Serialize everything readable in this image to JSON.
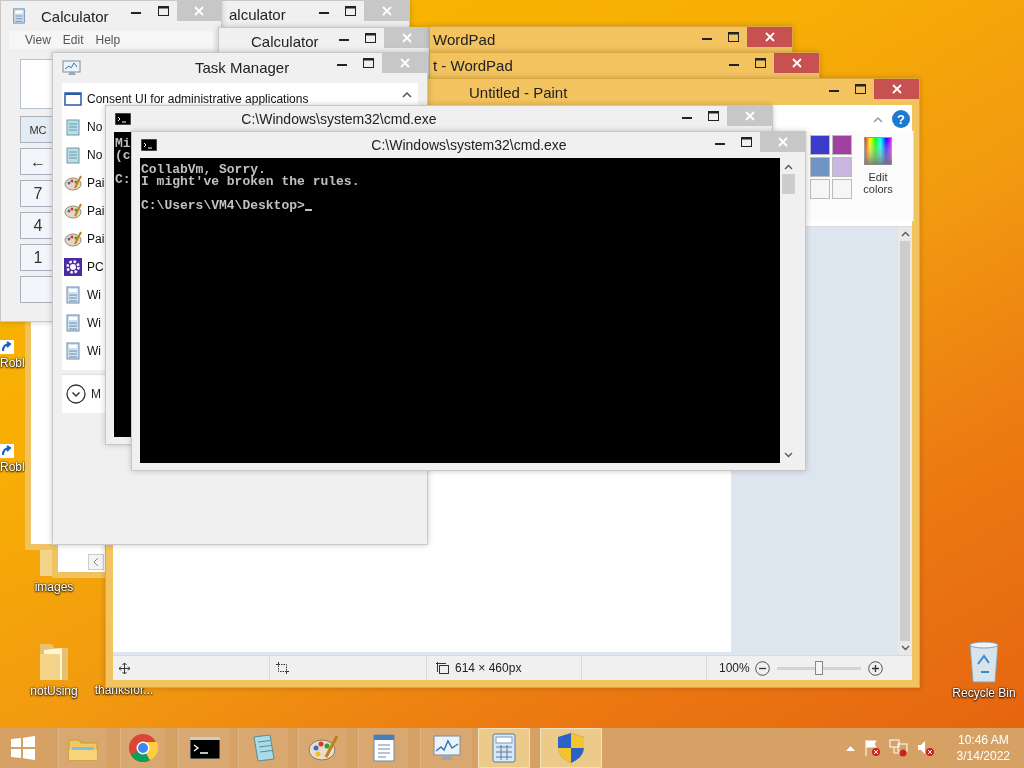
{
  "desktop": {
    "icons": [
      {
        "label": "Robl",
        "kind": "shortcut"
      },
      {
        "label": "Robl",
        "kind": "shortcut"
      },
      {
        "label": "images",
        "kind": "folder"
      },
      {
        "label": "notUsing",
        "kind": "folder"
      },
      {
        "label": "thanksfor...",
        "kind": "none"
      },
      {
        "label": "Recycle Bin",
        "kind": "bin"
      }
    ]
  },
  "calculators": [
    {
      "title": "Calculator",
      "menu": [
        "View",
        "Edit",
        "Help"
      ],
      "keys": [
        "MC",
        "←",
        "7",
        "4",
        "1"
      ]
    },
    {
      "title": "alculator"
    },
    {
      "title": "Calculator"
    }
  ],
  "wordpads": [
    {
      "title": "WordPad"
    },
    {
      "title": "t - WordPad"
    }
  ],
  "paint": {
    "title": "Untitled - Paint",
    "help": "?",
    "palette": [
      {
        "color": "#3c3ccc"
      },
      {
        "color": "#a040a0"
      },
      {
        "color": "#7094c4"
      },
      {
        "color": "#c8b8e0"
      },
      {
        "color": "#f6f6f6"
      },
      {
        "color": "#f6f6f6"
      }
    ],
    "edit_colors": "Edit colors",
    "status": {
      "size": "614 × 460px",
      "zoom": "100%",
      "zoom_slider": {
        "level": 0.5
      }
    }
  },
  "task_manager": {
    "title": "Task Manager",
    "items": [
      {
        "label": "Consent UI for administrative applications",
        "kind": "window"
      },
      {
        "label": "No",
        "kind": "notepad"
      },
      {
        "label": "No",
        "kind": "notepad"
      },
      {
        "label": "Pai",
        "kind": "paint"
      },
      {
        "label": "Pai",
        "kind": "paint"
      },
      {
        "label": "Pai",
        "kind": "paint"
      },
      {
        "label": "PC",
        "kind": "gear"
      },
      {
        "label": "Wi",
        "kind": "calculator"
      },
      {
        "label": "Wi",
        "kind": "calculator"
      },
      {
        "label": "Wi",
        "kind": "calculator"
      }
    ],
    "more": "M"
  },
  "consoles": [
    {
      "title": "C:\\Windows\\system32\\cmd.exe",
      "blocks": [
        [
          "Mi",
          "(c"
        ],
        [
          "C:"
        ]
      ],
      "cursor": false
    },
    {
      "title": "C:\\Windows\\system32\\cmd.exe",
      "blocks": [
        [
          "CollabVm, Sorry.",
          "I might've broken the rules."
        ],
        [
          "C:\\Users\\VM4\\Desktop>"
        ]
      ],
      "cursor": true
    }
  ],
  "taskbar": {
    "items": [
      {
        "kind": "start",
        "selected": false
      },
      {
        "kind": "folder",
        "selected": false
      },
      {
        "kind": "chrome",
        "selected": false
      },
      {
        "kind": "cmd",
        "selected": false
      },
      {
        "kind": "notepad",
        "selected": false
      },
      {
        "kind": "paint",
        "selected": false
      },
      {
        "kind": "wordpad",
        "selected": false
      },
      {
        "kind": "monitor",
        "selected": false
      },
      {
        "kind": "calculator",
        "selected": true
      },
      {
        "kind": "shield",
        "selected": true
      }
    ],
    "time": "10:46 AM",
    "date": "3/14/2022"
  }
}
